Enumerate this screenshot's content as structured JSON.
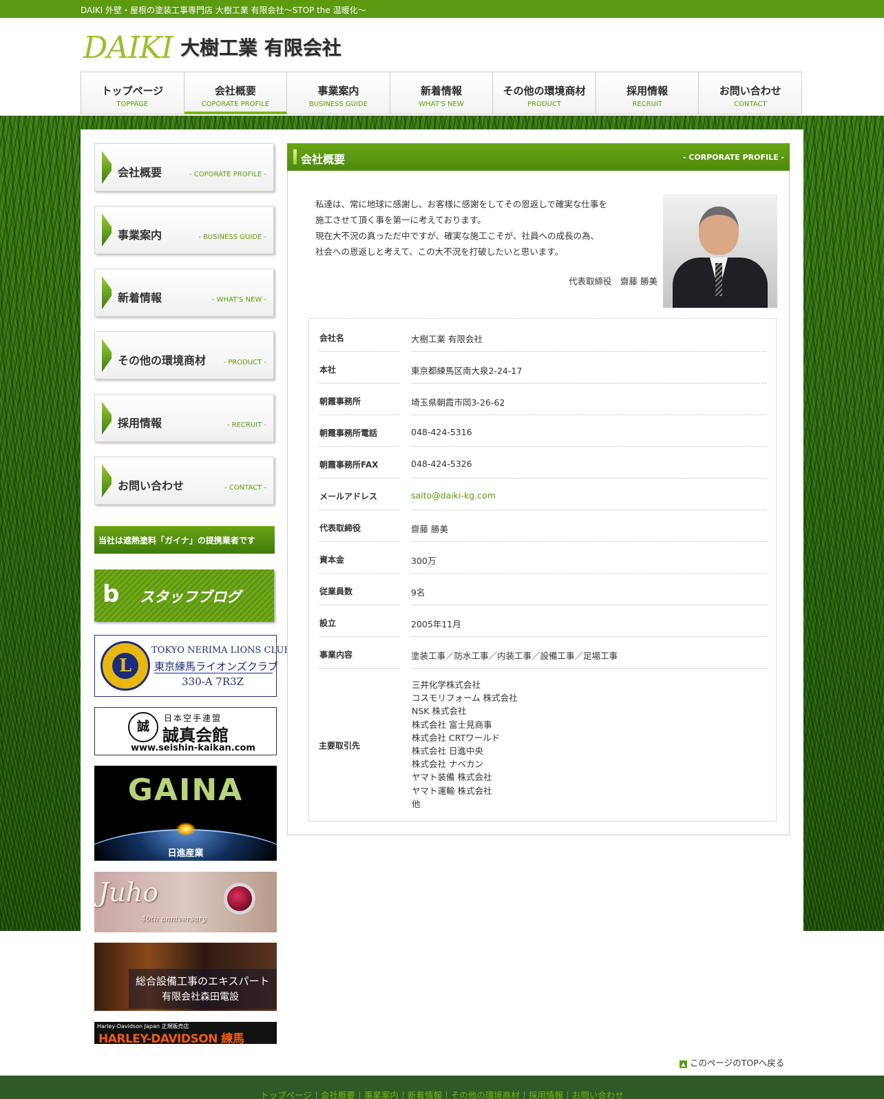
{
  "topbar": {
    "tagline": "DAIKI 外壁・屋根の塗装工事専門店 大樹工業 有限会社〜STOP the 温暖化〜"
  },
  "header": {
    "logo_text": "DAIKI",
    "company_name": "大樹工業 有限会社"
  },
  "gnav": [
    {
      "ja": "トップページ",
      "en": "TOPPAGE"
    },
    {
      "ja": "会社概要",
      "en": "COPORATE PROFILE"
    },
    {
      "ja": "事業案内",
      "en": "BUSINESS GUIDE"
    },
    {
      "ja": "新着情報",
      "en": "WHAT'S NEW"
    },
    {
      "ja": "その他の環境商材",
      "en": "PRODUCT"
    },
    {
      "ja": "採用情報",
      "en": "RECRUIT"
    },
    {
      "ja": "お問い合わせ",
      "en": "CONTACT"
    }
  ],
  "sidebar": {
    "items": [
      {
        "ja": "会社概要",
        "en": "- COPORATE PROFILE -"
      },
      {
        "ja": "事業案内",
        "en": "- BUSINESS GUIDE -"
      },
      {
        "ja": "新着情報",
        "en": "- WHAT'S NEW -"
      },
      {
        "ja": "その他の環境商材",
        "en": "- PRODUCT -"
      },
      {
        "ja": "採用情報",
        "en": "- RECRUIT -"
      },
      {
        "ja": "お問い合わせ",
        "en": "- CONTACT -"
      }
    ],
    "gaina_banner": "当社は遮熱塗料「ガイナ」の提携業者です",
    "blog_icon": "b",
    "blog_banner": "スタッフブログ",
    "lions": {
      "logo_letter": "L",
      "line1": "TOKYO NERIMA LIONS CLUB",
      "line2": "東京練馬ライオンズクラブ",
      "line3": "330-A 7R3Z"
    },
    "seishin": {
      "emblem": "誠",
      "small": "日本空手連盟",
      "big": "誠真会館",
      "url": "www.seishin-kaikan.com"
    },
    "gaina_ad": {
      "word": "GAINA",
      "maker": "日進産業"
    },
    "juho": {
      "word": "Juho",
      "anniversary": "40th anniversary"
    },
    "morita": {
      "line1": "総合設備工事のエキスパート",
      "line2": "有限会社森田電設"
    },
    "harley": {
      "small": "Harley-Davidson Japan 正規販売店",
      "big": "HARLEY-DAVIDSON 練馬"
    }
  },
  "main": {
    "title": "会社概要",
    "title_en": "- CORPORATE PROFILE -",
    "message": [
      "私達は、常に地球に感謝し、お客様に感謝をしてその恩返しで確実な仕事を",
      "施工させて頂く事を第一に考えております。",
      "現在大不況の真っただ中ですが、確実な施工こそが、社員への成長の為、",
      "社会への恩返しと考えて、この大不況を打破したいと思います。"
    ],
    "signature": "代表取締役　齋藤 勝美",
    "info": [
      {
        "label": "会社名",
        "value": "大樹工業 有限会社"
      },
      {
        "label": "本社",
        "value": "東京都練馬区南大泉2-24-17"
      },
      {
        "label": "朝霞事務所",
        "value": "埼玉県朝霞市岡3-26-62"
      },
      {
        "label": "朝霞事務所電話",
        "value": "048-424-5316"
      },
      {
        "label": "朝霞事務所FAX",
        "value": "048-424-5326"
      },
      {
        "label": "メールアドレス",
        "value": "saito@daiki-kg.com"
      },
      {
        "label": "代表取締役",
        "value": "齋藤 勝美"
      },
      {
        "label": "資本金",
        "value": "300万"
      },
      {
        "label": "従業員数",
        "value": "9名"
      },
      {
        "label": "設立",
        "value": "2005年11月"
      },
      {
        "label": "事業内容",
        "value": "塗装工事／防水工事／内装工事／設備工事／足場工事"
      }
    ],
    "clients_label": "主要取引先",
    "clients": [
      "三井化学株式会社",
      "コスモリフォーム 株式会社",
      "NSK 株式会社",
      "株式会社 富士見商事",
      "株式会社 CRTワールド",
      "株式会社 日進中央",
      "株式会社 ナベカン",
      "ヤマト装備 株式会社",
      "ヤマト運輸 株式会社",
      "他"
    ]
  },
  "pagetop": {
    "icon": "▲",
    "label": "このページのTOPへ戻る"
  },
  "footer": {
    "links": [
      "トップページ",
      "会社概要",
      "事業案内",
      "新着情報",
      "その他の環境商材",
      "採用情報",
      "お問い合わせ"
    ]
  },
  "colors": {
    "brand_green": "#5c9a0f",
    "footer_green": "#2f5a26"
  }
}
